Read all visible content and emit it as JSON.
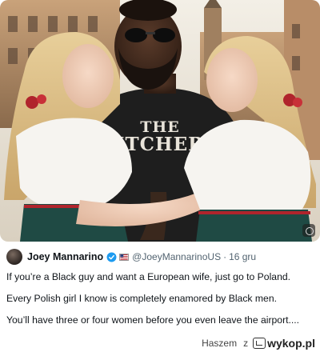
{
  "photo": {
    "alt": "AI-generated photo",
    "shirt_line1": "THE",
    "shirt_line2": "ITCHER"
  },
  "tweet": {
    "author_name": "Joey Mannarino",
    "handle": "@JoeyMannarinoUS",
    "separator": "·",
    "date": "16 gru",
    "lines": [
      "If you’re a Black guy and want a European wife, just go to Poland.",
      "Every Polish girl I know is completely enamored by Black men.",
      "You’ll have three or four women before you even leave the airport...."
    ]
  },
  "footer": {
    "author": "Haszem",
    "conjunction": "z",
    "site": "wykop.pl"
  },
  "colors": {
    "verified_blue": "#1d9bf0",
    "text_primary": "#0f1419",
    "text_secondary": "#536471"
  }
}
